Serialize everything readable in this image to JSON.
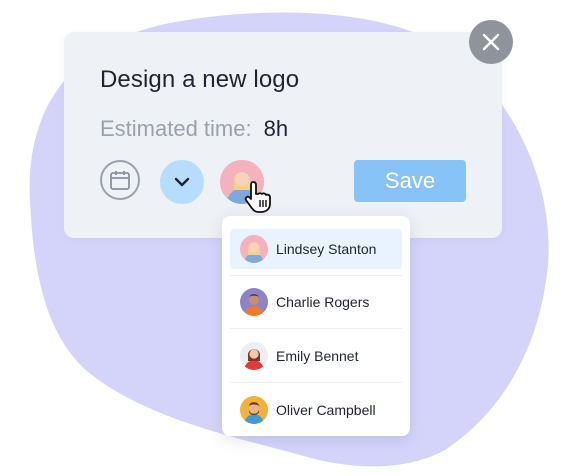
{
  "task": {
    "title": "Design a new logo",
    "estimate_label": "Estimated time:",
    "estimate_value": "8h"
  },
  "actions": {
    "calendar_icon": "calendar-icon",
    "expand_icon": "chevron-down-icon",
    "save_label": "Save",
    "close_icon": "close-icon"
  },
  "assignee_menu": {
    "items": [
      {
        "name": "Lindsey Stanton",
        "selected": true,
        "avatar_bg": "#f4b2bd"
      },
      {
        "name": "Charlie Rogers",
        "selected": false,
        "avatar_bg": "#8c83c9"
      },
      {
        "name": "Emily Bennet",
        "selected": false,
        "avatar_bg": "#eceef2"
      },
      {
        "name": "Oliver Campbell",
        "selected": false,
        "avatar_bg": "#f2b13a"
      }
    ]
  },
  "colors": {
    "blob": "#d4d4fb",
    "card_bg": "#eef1f6",
    "save_bg": "#88c3f7",
    "chevron_btn_bg": "#b6dcff",
    "selected_row_bg": "#e8f3ff",
    "close_bg": "#8e939c"
  }
}
